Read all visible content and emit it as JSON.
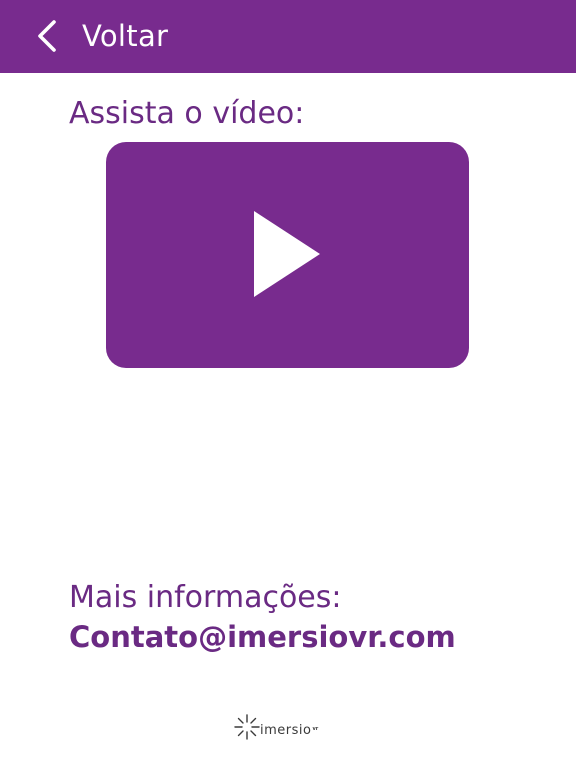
{
  "header": {
    "back_label": "Voltar",
    "background_color": "#782b8e",
    "back_icon": "chevron-left-icon"
  },
  "video": {
    "title": "Assista o vídeo:",
    "player_color": "#782b8e",
    "play_icon": "play-icon"
  },
  "info": {
    "title": "Mais informações:",
    "email": "Contato@imersiovr.com",
    "text_color": "#6a2a83"
  },
  "footer": {
    "logo_text": "imersio",
    "logo_superscript": "vr",
    "logo_icon": "starburst-logo-icon"
  }
}
